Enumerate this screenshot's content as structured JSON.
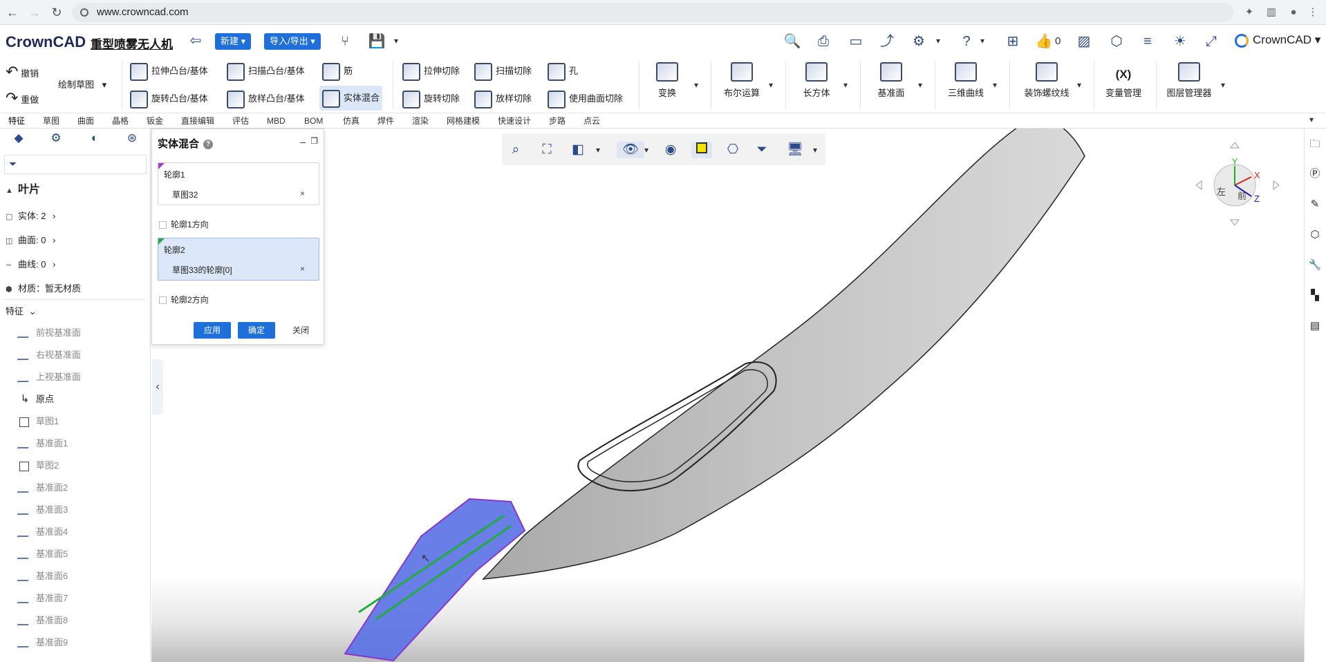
{
  "browser": {
    "url": "www.crowncad.com"
  },
  "app": {
    "logo": "CrownCAD",
    "project_title": "重型喷雾无人机",
    "new_button": "新建",
    "import_export": "导入/导出",
    "like_count": "0",
    "brand": "CrownCAD"
  },
  "ribbon": {
    "undo": "撤销",
    "redo": "重做",
    "sketch": "绘制草图",
    "features": {
      "extrude_boss": "拉伸凸台/基体",
      "sweep_boss": "扫描凸台/基体",
      "rib": "筋",
      "revolve_boss": "旋转凸台/基体",
      "loft_boss": "放样凸台/基体",
      "solid_blend": "实体混合",
      "extrude_cut": "拉伸切除",
      "sweep_cut": "扫描切除",
      "hole": "孔",
      "revolve_cut": "旋转切除",
      "loft_cut": "放样切除",
      "surface_cut": "使用曲面切除"
    },
    "large": [
      "变换",
      "布尔运算",
      "长方体",
      "基准面",
      "三维曲线",
      "装饰螺纹线",
      "变量管理",
      "图层管理器"
    ]
  },
  "tabs": [
    "特征",
    "草图",
    "曲面",
    "晶格",
    "钣金",
    "直接编辑",
    "评估",
    "MBD",
    "BOM",
    "仿真",
    "焊件",
    "渲染",
    "网格建模",
    "快速设计",
    "步路",
    "点云"
  ],
  "tree": {
    "root": "叶片",
    "solids": "实体: 2",
    "surfaces": "曲面: 0",
    "curves": "曲线: 0",
    "material": "材质：暂无材质",
    "features_header": "特征",
    "items": [
      "前视基准面",
      "右视基准面",
      "上视基准面",
      "原点",
      "草图1",
      "基准面1",
      "草图2",
      "基准面2",
      "基准面3",
      "基准面4",
      "基准面5",
      "基准面6",
      "基准面7",
      "基准面8",
      "基准面9"
    ]
  },
  "dialog": {
    "title": "实体混合",
    "profile1_label": "轮廓1",
    "profile1_value": "草图32",
    "profile1_dir": "轮廓1方向",
    "profile2_label": "轮廓2",
    "profile2_value": "草图33的轮廓[0]",
    "profile2_dir": "轮廓2方向",
    "apply": "应用",
    "ok": "确定",
    "close": "关闭"
  },
  "viewcube": {
    "x": "X",
    "y": "Y",
    "z": "Z",
    "left": "左",
    "front": "前"
  }
}
